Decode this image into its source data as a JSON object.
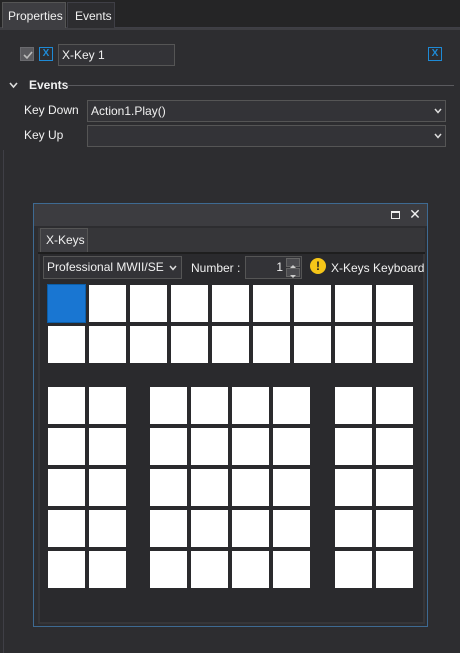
{
  "tabs": [
    {
      "label": "Properties",
      "active": true
    },
    {
      "label": "Events",
      "active": false
    }
  ],
  "properties": {
    "enabled_checked": true,
    "x_badge": "X",
    "name_value": "X-Key 1",
    "right_badge": "X"
  },
  "events_section": {
    "title": "Events",
    "expanded": true,
    "rows": [
      {
        "label": "Key Down",
        "value": "Action1.Play()"
      },
      {
        "label": "Key Up",
        "value": ""
      }
    ]
  },
  "window": {
    "maximize_icon": "maximize-icon",
    "close_icon": "close-icon",
    "close_glyph": "✕",
    "tab_label": "X-Keys",
    "model_select": {
      "value": "Professional MWII/SE"
    },
    "number_label": "Number :",
    "number_value": "1",
    "warning_glyph": "!",
    "keyboard_label": "X-Keys Keyboard",
    "selected_key_index": 0
  },
  "colors": {
    "background": "#2d2d30",
    "accent": "#1e8ad6",
    "selected_key": "#1976d2",
    "warning": "#f5c518"
  }
}
